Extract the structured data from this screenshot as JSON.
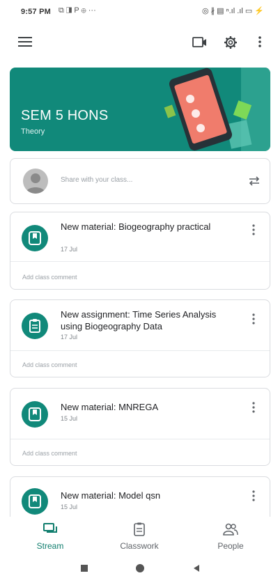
{
  "status_bar": {
    "time": "9:57 PM",
    "left_icons": "⧉ ◨ P ⊕ ···",
    "right_icons": "◎ ∦ ▤ ⁿ.ıl .ıl ▭ ⚡"
  },
  "banner": {
    "title": "SEM 5 HONS",
    "subtitle": "Theory",
    "color": "#11897a"
  },
  "share": {
    "placeholder": "Share with your class..."
  },
  "posts": [
    {
      "icon": "material-icon",
      "title": "New material: Biogeography practical",
      "date": "17 Jul",
      "comment": "Add class comment"
    },
    {
      "icon": "assignment-icon",
      "title": "New assignment: Time Series Analysis using Biogeography Data",
      "date": "17 Jul",
      "comment": "Add class comment"
    },
    {
      "icon": "material-icon",
      "title": "New material: MNREGA",
      "date": "15 Jul",
      "comment": "Add class comment"
    },
    {
      "icon": "material-icon",
      "title": "New material: Model qsn",
      "date": "15 Jul",
      "comment": ""
    }
  ],
  "bottom_nav": {
    "stream": "Stream",
    "classwork": "Classwork",
    "people": "People"
  },
  "accent_color": "#0f7d6d"
}
